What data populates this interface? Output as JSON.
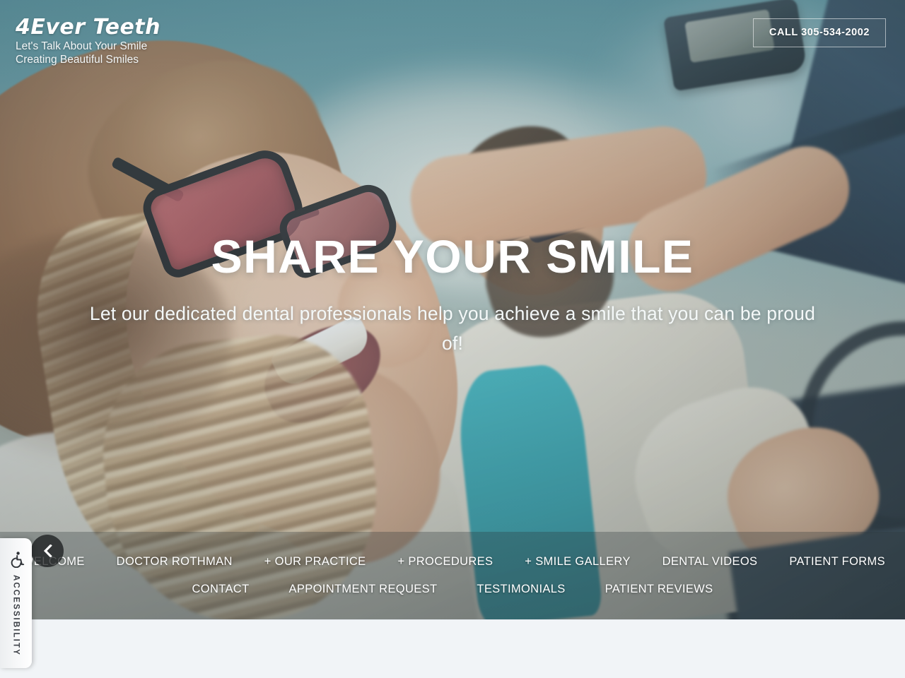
{
  "brand": {
    "name": "4Ever Teeth",
    "tagline_line1": "Let's Talk About Your Smile",
    "tagline_line2": "Creating Beautiful Smiles"
  },
  "header": {
    "call_button": "CALL 305-534-2002"
  },
  "hero": {
    "title": "SHARE YOUR SMILE",
    "subtitle": "Let our dedicated dental professionals help you achieve a smile that you can be proud of!"
  },
  "slider": {
    "prev_label": "‹"
  },
  "nav": {
    "row1": [
      {
        "label": "WELCOME"
      },
      {
        "label": "DOCTOR ROTHMAN"
      },
      {
        "label": "+ OUR PRACTICE"
      },
      {
        "label": "+ PROCEDURES"
      },
      {
        "label": "+ SMILE GALLERY"
      },
      {
        "label": "DENTAL VIDEOS"
      },
      {
        "label": "PATIENT FORMS"
      }
    ],
    "row2": [
      {
        "label": "CONTACT"
      },
      {
        "label": "APPOINTMENT REQUEST"
      },
      {
        "label": "TESTIMONIALS"
      },
      {
        "label": "PATIENT REVIEWS"
      }
    ]
  },
  "accessibility": {
    "label": "ACCESSIBILITY",
    "icon": "wheelchair-icon"
  },
  "colors": {
    "hero_sky": "#5d9aa6",
    "text_on_hero": "#ffffff",
    "nav_overlay": "rgba(42,54,56,0.30)",
    "below_fold_bg": "#f1f4f7",
    "a11y_panel_bg": "#f7f8f9"
  }
}
